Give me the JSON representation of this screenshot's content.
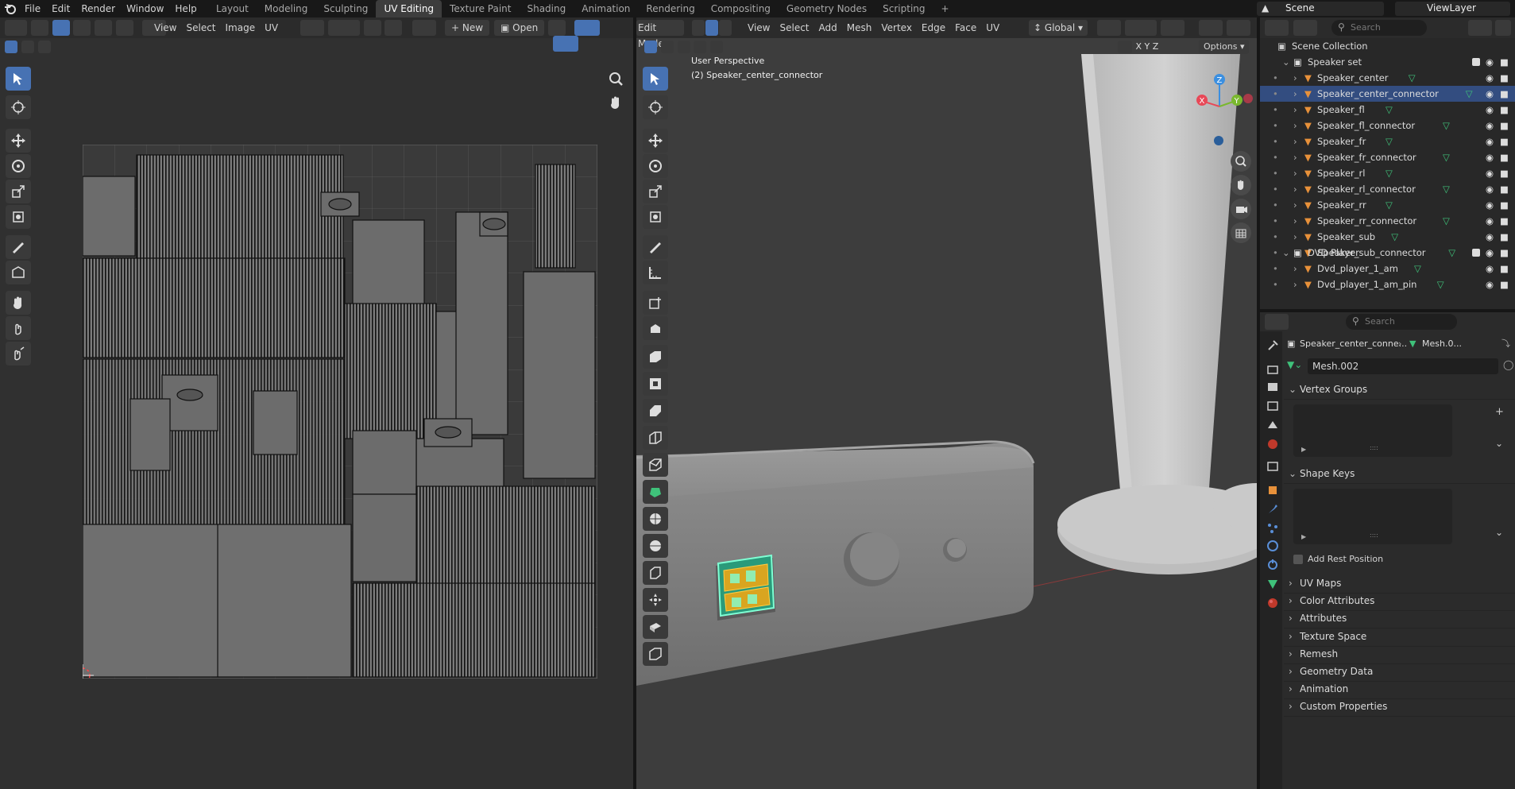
{
  "app_logo": "blender-logo-icon",
  "menus": [
    "File",
    "Edit",
    "Render",
    "Window",
    "Help"
  ],
  "workspaces": [
    "Layout",
    "Modeling",
    "Sculpting",
    "UV Editing",
    "Texture Paint",
    "Shading",
    "Animation",
    "Rendering",
    "Compositing",
    "Geometry Nodes",
    "Scripting"
  ],
  "active_workspace": "UV Editing",
  "scene_name": "Scene",
  "view_layer": "ViewLayer",
  "uv_editor": {
    "menus": [
      "View",
      "Select",
      "Image",
      "UV"
    ],
    "new_label": "New",
    "open_label": "Open"
  },
  "viewport": {
    "mode": "Edit Mode",
    "menus": [
      "View",
      "Select",
      "Add",
      "Mesh",
      "Vertex",
      "Edge",
      "Face",
      "UV"
    ],
    "orientation": "Global",
    "options_label": "Options",
    "perspective_label": "User Perspective",
    "active_object_label": "(2) Speaker_center_connector",
    "axis_labels": {
      "x": "X",
      "y": "Y",
      "z": "Z"
    }
  },
  "outliner": {
    "search_placeholder": "Search",
    "root": "Scene Collection",
    "collections": [
      {
        "name": "Speaker set",
        "items": [
          "Speaker_center",
          "Speaker_center_connector",
          "Speaker_fl",
          "Speaker_fl_connector",
          "Speaker_fr",
          "Speaker_fr_connector",
          "Speaker_rl",
          "Speaker_rl_connector",
          "Speaker_rr",
          "Speaker_rr_connector",
          "Speaker_sub",
          "Speaker_sub_connector"
        ]
      },
      {
        "name": "DVD Player",
        "items": [
          "Dvd_player_1_am",
          "Dvd_player_1_am_pin"
        ]
      }
    ],
    "selected_item": "Speaker_center_connector"
  },
  "properties": {
    "search_placeholder": "Search",
    "breadcrumb_object": "Speaker_center_conne...",
    "breadcrumb_data": "Mesh.0...",
    "mesh_name": "Mesh.002",
    "sections": {
      "vertex_groups": "Vertex Groups",
      "shape_keys": "Shape Keys",
      "add_rest_position": "Add Rest Position",
      "collapsed": [
        "UV Maps",
        "Color Attributes",
        "Attributes",
        "Texture Space",
        "Remesh",
        "Geometry Data",
        "Animation",
        "Custom Properties"
      ]
    }
  },
  "colors": {
    "accent": "#4772b3",
    "object_orange": "#e8913a",
    "mesh_green": "#3fc27a",
    "axis_x": "#e84857",
    "axis_y": "#7ab82e",
    "axis_z": "#3b8fe0"
  }
}
